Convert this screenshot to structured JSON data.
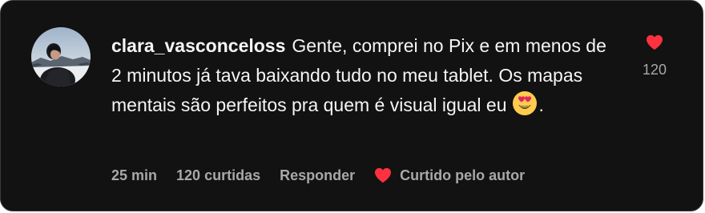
{
  "comment": {
    "username": "clara_vasconceloss",
    "text_before_emoji": "Gente, comprei no Pix e em menos de 2 minutos já tava baixando tudo no meu tablet. Os mapas mentais são perfeitos pra quem é visual igual eu",
    "emoji": "heart-eyes-emoji",
    "text_after_emoji": "."
  },
  "meta": {
    "time": "25 min",
    "likes_text": "120 curtidas",
    "reply_label": "Responder",
    "liked_by_author": "Curtido pelo autor"
  },
  "like": {
    "count": "120",
    "icon": "heart-icon",
    "color": "#ff3040"
  }
}
